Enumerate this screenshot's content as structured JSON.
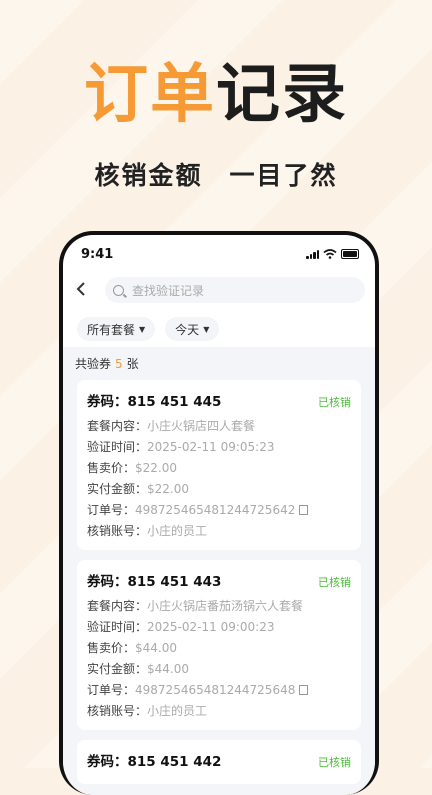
{
  "hero": {
    "title_orange": "订单",
    "title_dark": "记录",
    "subtitle": "核销金额　一目了然"
  },
  "status": {
    "time": "9:41"
  },
  "search": {
    "placeholder": "查找验证记录"
  },
  "filters": [
    {
      "label": "所有套餐"
    },
    {
      "label": "今天"
    }
  ],
  "summary": {
    "prefix": "共验券",
    "count": "5",
    "suffix": "张"
  },
  "labels": {
    "code": "券码：",
    "content": "套餐内容：",
    "time": "验证时间：",
    "price": "售卖价：",
    "paid": "实付金额：",
    "order": "订单号：",
    "account": "核销账号："
  },
  "records": [
    {
      "code": "815 451 445",
      "status": "已核销",
      "content": "小庄火锅店四人套餐",
      "time": "2025-02-11 09:05:23",
      "price": "$22.00",
      "paid": "$22.00",
      "order": "498725465481244725642",
      "account": "小庄的员工"
    },
    {
      "code": "815 451 443",
      "status": "已核销",
      "content": "小庄火锅店番茄汤锅六人套餐",
      "time": "2025-02-11 09:00:23",
      "price": "$44.00",
      "paid": "$44.00",
      "order": "498725465481244725648",
      "account": "小庄的员工"
    },
    {
      "code": "815 451 442",
      "status": "已核销"
    }
  ]
}
